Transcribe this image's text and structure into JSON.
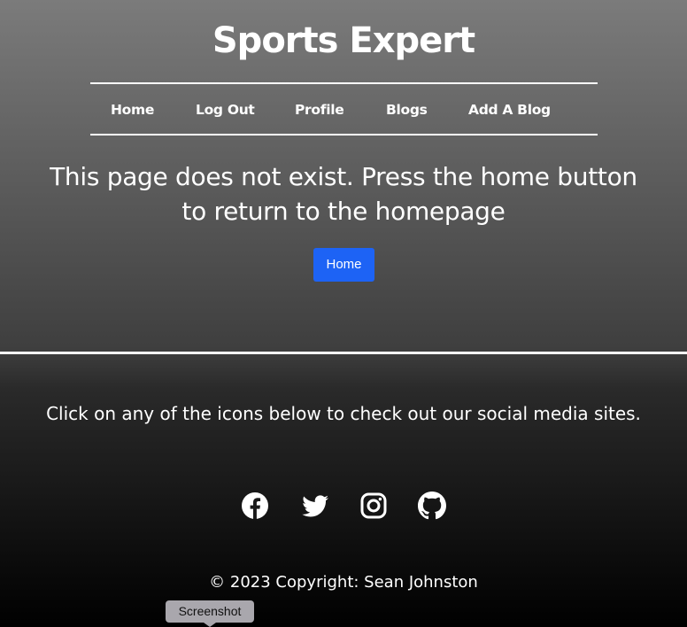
{
  "site": {
    "title": "Sports Expert"
  },
  "nav": {
    "items": [
      {
        "label": "Home"
      },
      {
        "label": "Log Out"
      },
      {
        "label": "Profile"
      },
      {
        "label": "Blogs"
      },
      {
        "label": "Add A Blog"
      }
    ]
  },
  "main": {
    "message": "This page does not exist. Press the home button to return to the homepage",
    "home_button_label": "Home"
  },
  "footer": {
    "social_text": "Click on any of the icons below to check out our social media sites.",
    "social_icons": [
      "facebook-icon",
      "twitter-icon",
      "instagram-icon",
      "github-icon"
    ],
    "copyright": "© 2023 Copyright: Sean Johnston"
  },
  "tooltip": {
    "label": "Screenshot"
  },
  "colors": {
    "button_blue": "#1d63f5",
    "tooltip_gray": "#a9a7ad",
    "text": "#ffffff"
  }
}
